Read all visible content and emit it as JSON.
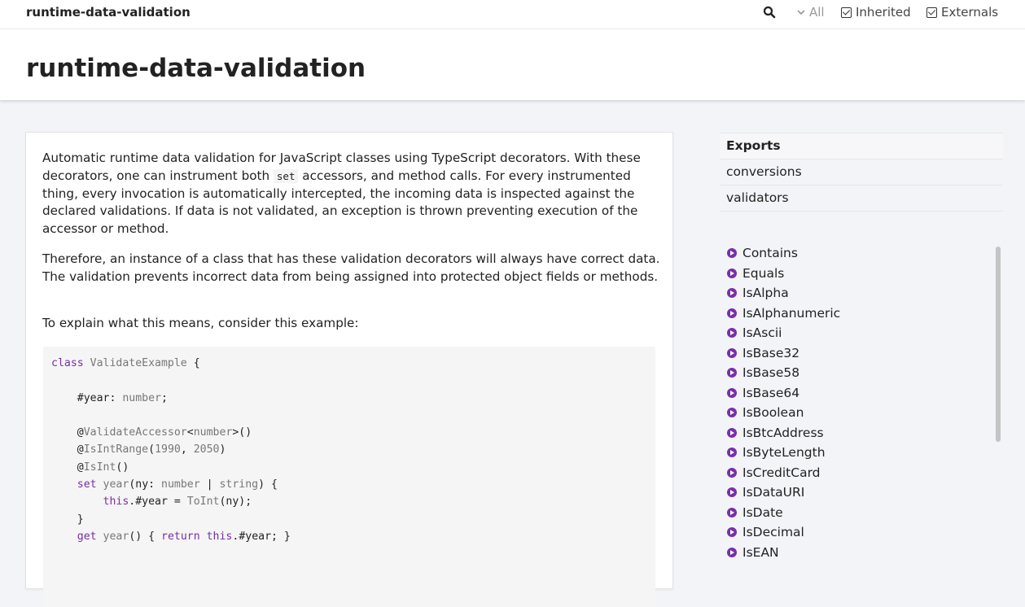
{
  "topbar": {
    "brand": "runtime-data-validation",
    "visibility_label": "All",
    "inherited_label": "Inherited",
    "externals_label": "Externals"
  },
  "header": {
    "title": "runtime-data-validation"
  },
  "content": {
    "para1_a": "Automatic runtime data validation for JavaScript classes using TypeScript decorators. With these decorators, one can instrument both ",
    "para1_code": "set",
    "para1_b": " accessors, and method calls. For every instrumented thing, every invocation is automatically intercepted, the incoming data is inspected against the declared validations. If data is not validated, an exception is thrown preventing execution of the accessor or method.",
    "para2": "Therefore, an instance of a class that has these validation decorators will always have correct data. The validation prevents incorrect data from being assigned into protected object fields or methods.",
    "para3": "To explain what this means, consider this example:",
    "code_lines": [
      "class ValidateExample {",
      "",
      "    #year: number;",
      "",
      "    @ValidateAccessor<number>()",
      "    @IsIntRange(1990, 2050)",
      "    @IsInt()",
      "    set year(ny: number | string) {",
      "        this.#year = ToInt(ny);",
      "    }",
      "    get year() { return this.#year; }"
    ]
  },
  "sidebar": {
    "nav": [
      "Exports",
      "conversions",
      "validators"
    ],
    "functions": [
      "Contains",
      "Equals",
      "IsAlpha",
      "IsAlphanumeric",
      "IsAscii",
      "IsBase32",
      "IsBase58",
      "IsBase64",
      "IsBoolean",
      "IsBtcAddress",
      "IsByteLength",
      "IsCreditCard",
      "IsDataURI",
      "IsDate",
      "IsDecimal",
      "IsEAN"
    ]
  },
  "colors": {
    "accent": "#7a2ea8",
    "background": "#f2f4f8"
  }
}
